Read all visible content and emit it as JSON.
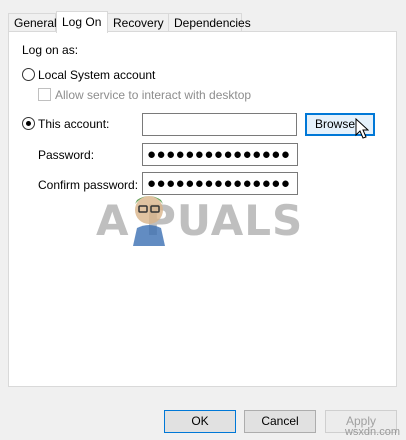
{
  "tabs": [
    "General",
    "Log On",
    "Recovery",
    "Dependencies"
  ],
  "logon": {
    "section_label": "Log on as:",
    "local_system_label": "Local System account",
    "allow_interact_label": "Allow service to interact with desktop",
    "this_account_label": "This account:",
    "this_account_value": "",
    "password_label": "Password:",
    "password_value": "●●●●●●●●●●●●●●●",
    "confirm_label": "Confirm password:",
    "confirm_value": "●●●●●●●●●●●●●●●",
    "browse_label": "Browse..."
  },
  "buttons": {
    "ok": "OK",
    "cancel": "Cancel",
    "apply": "Apply"
  },
  "watermark": {
    "text": "A  PUALS"
  },
  "site": "wsxdn.com",
  "state": {
    "selected_radio": "this_account",
    "allow_interact_checked": false,
    "active_tab": "Log On"
  }
}
